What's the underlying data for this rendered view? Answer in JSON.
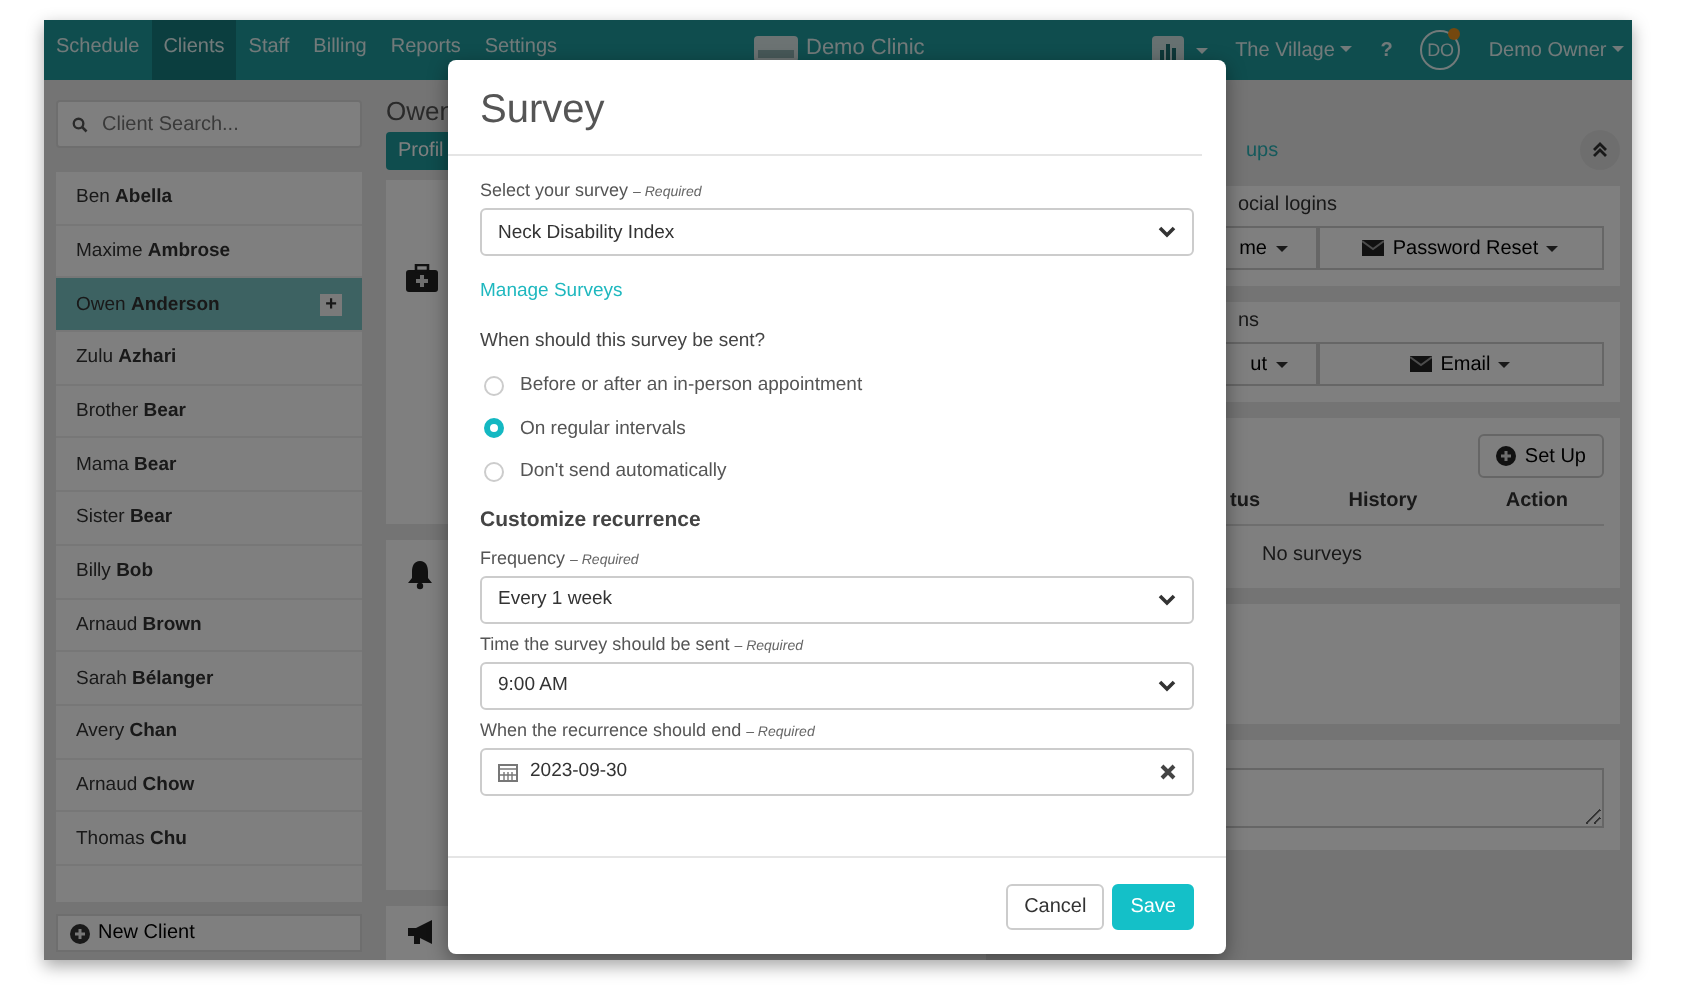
{
  "nav": {
    "items": [
      {
        "label": "Schedule",
        "selected": false
      },
      {
        "label": "Clients",
        "selected": true
      },
      {
        "label": "Staff",
        "selected": false
      },
      {
        "label": "Billing",
        "selected": false
      },
      {
        "label": "Reports",
        "selected": false
      },
      {
        "label": "Settings",
        "selected": false
      }
    ],
    "clinic_name": "Demo Clinic",
    "location": "The Village",
    "help": "?",
    "user": {
      "initials": "DO",
      "name": "Demo Owner",
      "notification": true
    }
  },
  "sidebar": {
    "search_placeholder": "Client Search...",
    "clients": [
      {
        "name": "Ben **Abella**",
        "selected": false
      },
      {
        "name": "Maxime **Ambrose**",
        "selected": false
      },
      {
        "name": "Owen **Anderson**",
        "selected": true
      },
      {
        "name": "Zulu **Azhari**",
        "selected": false
      },
      {
        "name": "Brother **Bear**",
        "selected": false
      },
      {
        "name": "Mama **Bear**",
        "selected": false
      },
      {
        "name": "Sister **Bear**",
        "selected": false
      },
      {
        "name": "Billy **Bob**",
        "selected": false
      },
      {
        "name": "Arnaud **Brown**",
        "selected": false
      },
      {
        "name": "Sarah **Bélanger**",
        "selected": false
      },
      {
        "name": "Avery **Chan**",
        "selected": false
      },
      {
        "name": "Arnaud **Chow**",
        "selected": false
      },
      {
        "name": "Thomas **Chu**",
        "selected": false
      }
    ],
    "add_button": "+",
    "new_client": "New Client"
  },
  "profile": {
    "heading": "Owen",
    "tab": "Profil"
  },
  "right": {
    "header_link": "ups",
    "panels": [
      {
        "kind": "buttons",
        "caption": "ocial logins",
        "buttons": [
          {
            "label": "me",
            "kind": "plain"
          },
          {
            "label": "Password Reset",
            "kind": "mail"
          }
        ]
      },
      {
        "kind": "buttons",
        "caption": "ns",
        "buttons": [
          {
            "label": "ut",
            "kind": "plain"
          },
          {
            "label": "Email",
            "kind": "mail"
          }
        ]
      },
      {
        "kind": "table",
        "action": "Set Up",
        "columns": [
          "tus",
          "History",
          "Action"
        ],
        "empty_text": "No surveys"
      },
      {
        "kind": "blank"
      },
      {
        "kind": "textarea"
      }
    ]
  },
  "modal": {
    "title": "Survey",
    "survey_field": {
      "label": "Select your survey",
      "required": "– Required",
      "value": "Neck Disability Index"
    },
    "manage_link": "Manage Surveys",
    "question": "When should this survey be sent?",
    "options": [
      {
        "label": "Before or after an in-person appointment",
        "selected": false
      },
      {
        "label": "On regular intervals",
        "selected": true
      },
      {
        "label": "Don't send automatically",
        "selected": false
      }
    ],
    "section_heading": "Customize recurrence",
    "fields": [
      {
        "kind": "select",
        "label": "Frequency",
        "required": "– Required",
        "value": "Every 1 week"
      },
      {
        "kind": "select",
        "label": "Time the survey should be sent",
        "required": "– Required",
        "value": "9:00 AM"
      },
      {
        "kind": "date",
        "label": "When the recurrence should end",
        "required": "– Required",
        "value": "2023-09-30"
      }
    ],
    "buttons": [
      {
        "label": "Cancel",
        "kind": "default"
      },
      {
        "label": "Save",
        "kind": "primary"
      }
    ]
  }
}
